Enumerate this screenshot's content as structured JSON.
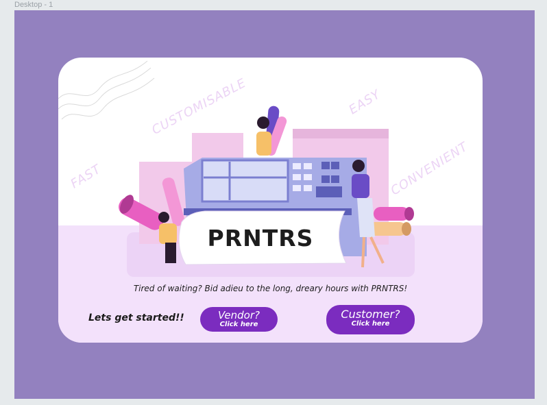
{
  "frame": {
    "label": "Desktop - 1"
  },
  "colors": {
    "artboard_bg": "#9381bf",
    "card_bg": "#ffffff",
    "card_lower_bg": "#f3e1fb",
    "button_bg": "#7b2cbf",
    "tag_color": "#ecd4f5"
  },
  "hero": {
    "feature_tags": [
      "FAST",
      "CUSTOMISABLE",
      "EASY",
      "CONVENIENT"
    ],
    "brand_banner": "PRNTRS"
  },
  "footer": {
    "tagline": "Tired of waiting? Bid adieu to the long, dreary hours with PRNTRS!",
    "cta_label": "Lets get started!!",
    "vendor_button": {
      "title": "Vendor?",
      "subtitle": "Click here"
    },
    "customer_button": {
      "title": "Customer?",
      "subtitle": "Click here"
    }
  }
}
